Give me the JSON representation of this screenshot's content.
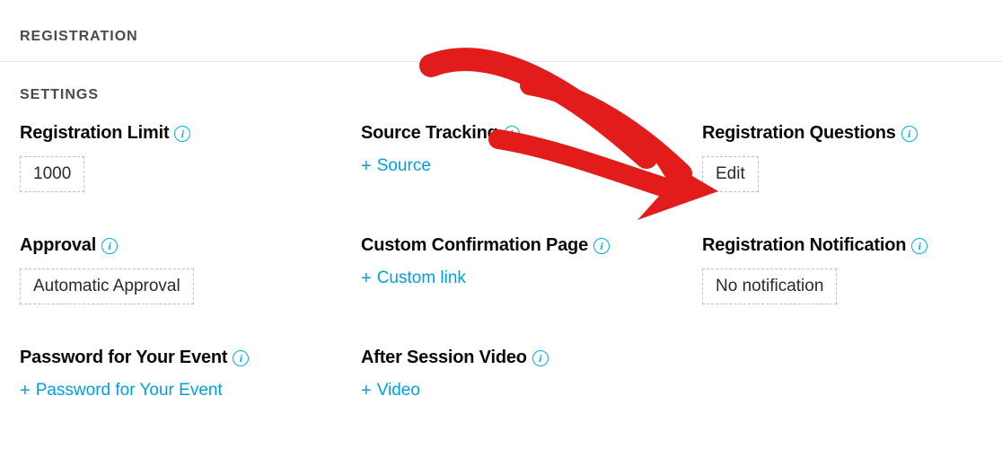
{
  "header": {
    "title": "REGISTRATION"
  },
  "settings": {
    "title": "SETTINGS",
    "reg_limit": {
      "label": "Registration Limit",
      "value": "1000"
    },
    "source_tracking": {
      "label": "Source Tracking",
      "add": "Source"
    },
    "reg_questions": {
      "label": "Registration Questions",
      "button": "Edit"
    },
    "approval": {
      "label": "Approval",
      "value": "Automatic Approval"
    },
    "custom_confirm": {
      "label": "Custom Confirmation Page",
      "add": "Custom link"
    },
    "reg_notification": {
      "label": "Registration Notification",
      "value": "No notification"
    },
    "password": {
      "label": "Password for Your Event",
      "add": "Password for Your Event"
    },
    "after_video": {
      "label": "After Session Video",
      "add": "Video"
    }
  }
}
